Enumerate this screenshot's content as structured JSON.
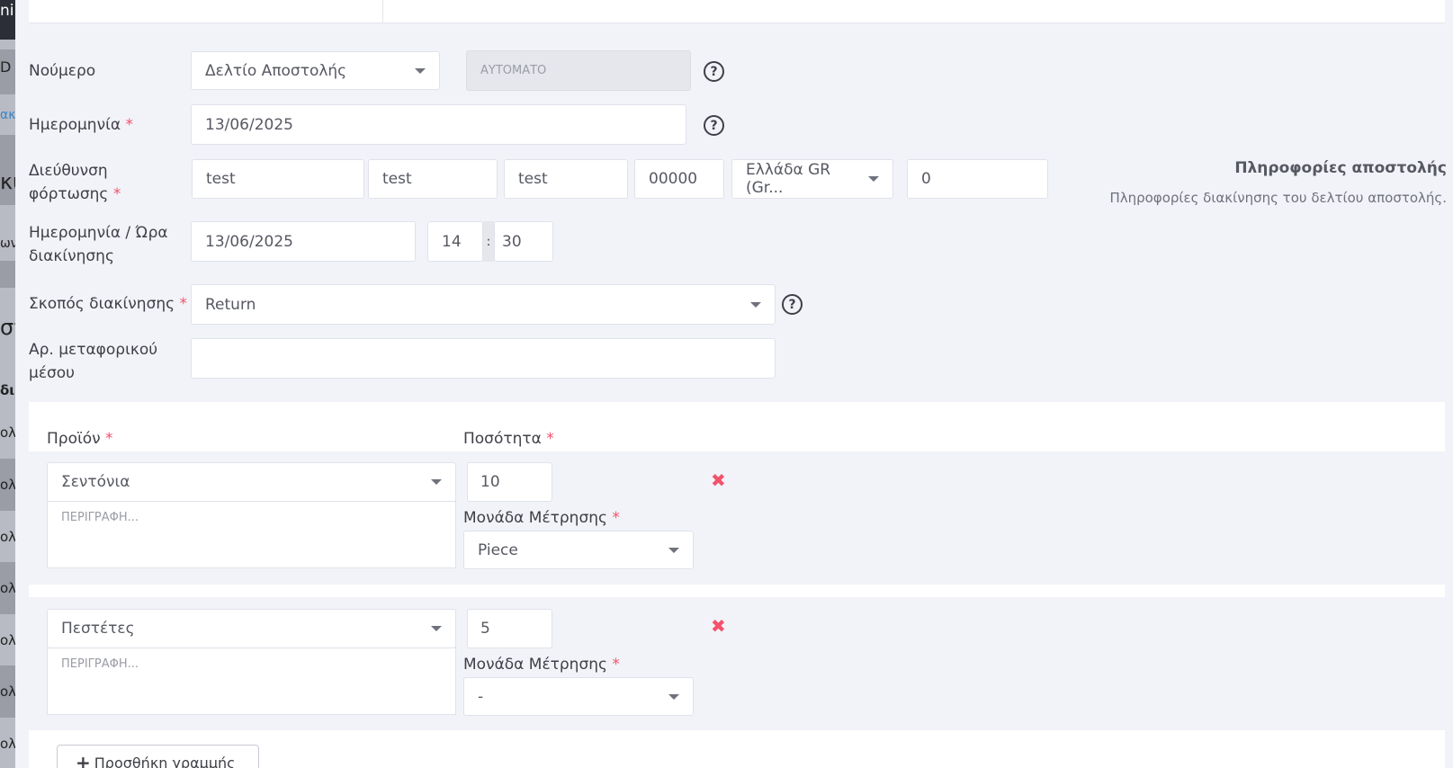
{
  "background": {
    "fragments": [
      "ni",
      "D",
      "ακί",
      "κύ",
      "ων",
      "στ",
      "δι",
      "ολ",
      "ολ",
      "ολ",
      "ολ",
      "ολ",
      "ολ",
      "ολ"
    ]
  },
  "form": {
    "number": {
      "label": "Νούμερο",
      "type_value": "Δελτίο Αποστολής",
      "auto_value": "ΑΥΤΟΜΑΤΟ"
    },
    "date": {
      "label": "Ημερομηνία",
      "required_mark": "*",
      "value": "13/06/2025"
    },
    "loading_address": {
      "label_line1": "Διεύθυνση",
      "label_line2": "φόρτωσης",
      "required_mark": "*",
      "street": "test",
      "number": "test",
      "city": "test",
      "postal_code": "00000",
      "country": "Ελλάδα GR (Gr...",
      "extra": "0"
    },
    "dispatch_datetime": {
      "label_line1": "Ημερομηνία / Ώρα",
      "label_line2": "διακίνησης",
      "date": "13/06/2025",
      "hour": "14",
      "separator": ":",
      "minute": "30"
    },
    "purpose": {
      "label": "Σκοπός διακίνησης",
      "required_mark": "*",
      "value": "Return"
    },
    "vehicle": {
      "label_line1": "Αρ. μεταφορικού",
      "label_line2": "μέσου",
      "value": ""
    }
  },
  "info": {
    "title": "Πληροφορίες αποστολής",
    "description": "Πληροφορίες διακίνησης του δελτίου αποστολής."
  },
  "lines": {
    "product_header": "Προϊόν",
    "quantity_header": "Ποσότητα",
    "required_mark": "*",
    "unit_label": "Μονάδα Μέτρησης",
    "description_placeholder": "ΠΕΡΙΓΡΑΦΗ...",
    "items": [
      {
        "product": "Σεντόνια",
        "quantity": "10",
        "unit": "Piece"
      },
      {
        "product": "Πεστέτες",
        "quantity": "5",
        "unit": "-"
      }
    ],
    "add_line_label": "Προσθήκη γραμμής",
    "add_icon": "+",
    "remove_icon": "✖"
  },
  "icons": {
    "help": "?"
  },
  "colors": {
    "required": "#f4516c",
    "remove": "#f4516c"
  }
}
